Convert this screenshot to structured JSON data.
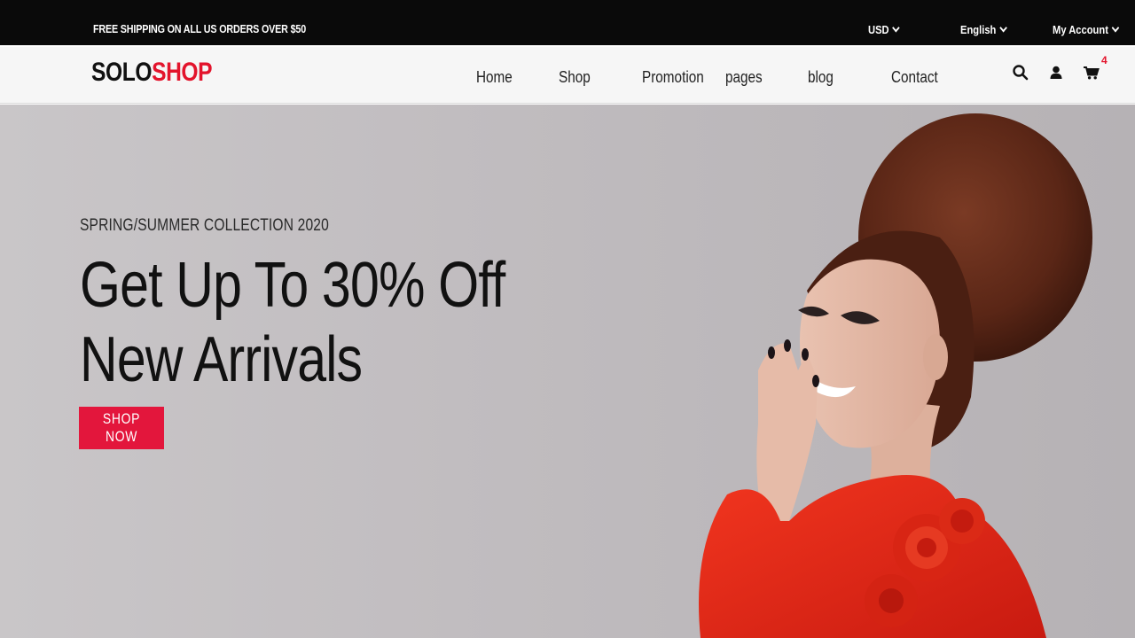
{
  "topbar": {
    "promo": "FREE SHIPPING ON ALL US ORDERS OVER $50",
    "currency": "USD",
    "language": "English",
    "account": "My Account"
  },
  "header": {
    "logo_part1": "SOLO",
    "logo_part2": "SHOP",
    "nav": [
      "Home",
      "Shop",
      "Promotion",
      "pages",
      "blog",
      "Contact"
    ],
    "cart_count": "4",
    "icons": [
      "search-icon",
      "user-icon",
      "cart-icon"
    ]
  },
  "hero": {
    "subtitle": "SPRING/SUMMER COLLECTION 2020",
    "headline_line1": "Get Up To 30% Off",
    "headline_line2": "New Arrivals",
    "cta": "SHOP NOW"
  },
  "colors": {
    "accent": "#e3142c",
    "topbar_bg": "#0a0a0a",
    "header_bg": "#f6f6f6",
    "hero_bg": "#c1bdc0"
  }
}
